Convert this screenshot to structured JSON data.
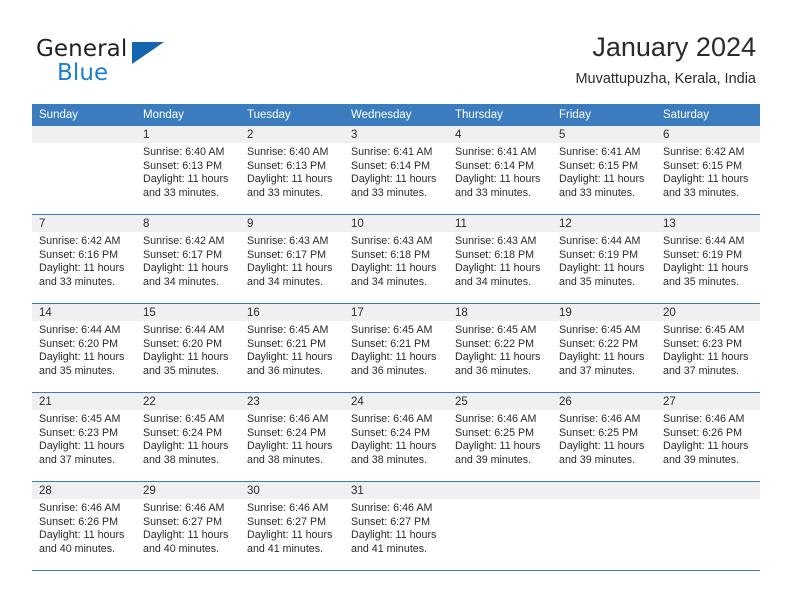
{
  "brand": {
    "name_part1": "General",
    "name_part2": "Blue",
    "logo_icon": "triangle-logo-icon"
  },
  "header": {
    "title": "January 2024",
    "subtitle": "Muvattupuzha, Kerala, India"
  },
  "colors": {
    "header_blue": "#3a7cbe",
    "brand_blue": "#1b7fd4",
    "daynum_band": "#f0f0f0",
    "text": "#2b2b2b"
  },
  "calendar": {
    "weekday_headers": [
      "Sunday",
      "Monday",
      "Tuesday",
      "Wednesday",
      "Thursday",
      "Friday",
      "Saturday"
    ],
    "weeks": [
      [
        {
          "day": "",
          "empty": true,
          "sunrise": "",
          "sunset": "",
          "daylight_line1": "",
          "daylight_line2": ""
        },
        {
          "day": "1",
          "empty": false,
          "sunrise": "Sunrise: 6:40 AM",
          "sunset": "Sunset: 6:13 PM",
          "daylight_line1": "Daylight: 11 hours",
          "daylight_line2": "and 33 minutes."
        },
        {
          "day": "2",
          "empty": false,
          "sunrise": "Sunrise: 6:40 AM",
          "sunset": "Sunset: 6:13 PM",
          "daylight_line1": "Daylight: 11 hours",
          "daylight_line2": "and 33 minutes."
        },
        {
          "day": "3",
          "empty": false,
          "sunrise": "Sunrise: 6:41 AM",
          "sunset": "Sunset: 6:14 PM",
          "daylight_line1": "Daylight: 11 hours",
          "daylight_line2": "and 33 minutes."
        },
        {
          "day": "4",
          "empty": false,
          "sunrise": "Sunrise: 6:41 AM",
          "sunset": "Sunset: 6:14 PM",
          "daylight_line1": "Daylight: 11 hours",
          "daylight_line2": "and 33 minutes."
        },
        {
          "day": "5",
          "empty": false,
          "sunrise": "Sunrise: 6:41 AM",
          "sunset": "Sunset: 6:15 PM",
          "daylight_line1": "Daylight: 11 hours",
          "daylight_line2": "and 33 minutes."
        },
        {
          "day": "6",
          "empty": false,
          "sunrise": "Sunrise: 6:42 AM",
          "sunset": "Sunset: 6:15 PM",
          "daylight_line1": "Daylight: 11 hours",
          "daylight_line2": "and 33 minutes."
        }
      ],
      [
        {
          "day": "7",
          "empty": false,
          "sunrise": "Sunrise: 6:42 AM",
          "sunset": "Sunset: 6:16 PM",
          "daylight_line1": "Daylight: 11 hours",
          "daylight_line2": "and 33 minutes."
        },
        {
          "day": "8",
          "empty": false,
          "sunrise": "Sunrise: 6:42 AM",
          "sunset": "Sunset: 6:17 PM",
          "daylight_line1": "Daylight: 11 hours",
          "daylight_line2": "and 34 minutes."
        },
        {
          "day": "9",
          "empty": false,
          "sunrise": "Sunrise: 6:43 AM",
          "sunset": "Sunset: 6:17 PM",
          "daylight_line1": "Daylight: 11 hours",
          "daylight_line2": "and 34 minutes."
        },
        {
          "day": "10",
          "empty": false,
          "sunrise": "Sunrise: 6:43 AM",
          "sunset": "Sunset: 6:18 PM",
          "daylight_line1": "Daylight: 11 hours",
          "daylight_line2": "and 34 minutes."
        },
        {
          "day": "11",
          "empty": false,
          "sunrise": "Sunrise: 6:43 AM",
          "sunset": "Sunset: 6:18 PM",
          "daylight_line1": "Daylight: 11 hours",
          "daylight_line2": "and 34 minutes."
        },
        {
          "day": "12",
          "empty": false,
          "sunrise": "Sunrise: 6:44 AM",
          "sunset": "Sunset: 6:19 PM",
          "daylight_line1": "Daylight: 11 hours",
          "daylight_line2": "and 35 minutes."
        },
        {
          "day": "13",
          "empty": false,
          "sunrise": "Sunrise: 6:44 AM",
          "sunset": "Sunset: 6:19 PM",
          "daylight_line1": "Daylight: 11 hours",
          "daylight_line2": "and 35 minutes."
        }
      ],
      [
        {
          "day": "14",
          "empty": false,
          "sunrise": "Sunrise: 6:44 AM",
          "sunset": "Sunset: 6:20 PM",
          "daylight_line1": "Daylight: 11 hours",
          "daylight_line2": "and 35 minutes."
        },
        {
          "day": "15",
          "empty": false,
          "sunrise": "Sunrise: 6:44 AM",
          "sunset": "Sunset: 6:20 PM",
          "daylight_line1": "Daylight: 11 hours",
          "daylight_line2": "and 35 minutes."
        },
        {
          "day": "16",
          "empty": false,
          "sunrise": "Sunrise: 6:45 AM",
          "sunset": "Sunset: 6:21 PM",
          "daylight_line1": "Daylight: 11 hours",
          "daylight_line2": "and 36 minutes."
        },
        {
          "day": "17",
          "empty": false,
          "sunrise": "Sunrise: 6:45 AM",
          "sunset": "Sunset: 6:21 PM",
          "daylight_line1": "Daylight: 11 hours",
          "daylight_line2": "and 36 minutes."
        },
        {
          "day": "18",
          "empty": false,
          "sunrise": "Sunrise: 6:45 AM",
          "sunset": "Sunset: 6:22 PM",
          "daylight_line1": "Daylight: 11 hours",
          "daylight_line2": "and 36 minutes."
        },
        {
          "day": "19",
          "empty": false,
          "sunrise": "Sunrise: 6:45 AM",
          "sunset": "Sunset: 6:22 PM",
          "daylight_line1": "Daylight: 11 hours",
          "daylight_line2": "and 37 minutes."
        },
        {
          "day": "20",
          "empty": false,
          "sunrise": "Sunrise: 6:45 AM",
          "sunset": "Sunset: 6:23 PM",
          "daylight_line1": "Daylight: 11 hours",
          "daylight_line2": "and 37 minutes."
        }
      ],
      [
        {
          "day": "21",
          "empty": false,
          "sunrise": "Sunrise: 6:45 AM",
          "sunset": "Sunset: 6:23 PM",
          "daylight_line1": "Daylight: 11 hours",
          "daylight_line2": "and 37 minutes."
        },
        {
          "day": "22",
          "empty": false,
          "sunrise": "Sunrise: 6:45 AM",
          "sunset": "Sunset: 6:24 PM",
          "daylight_line1": "Daylight: 11 hours",
          "daylight_line2": "and 38 minutes."
        },
        {
          "day": "23",
          "empty": false,
          "sunrise": "Sunrise: 6:46 AM",
          "sunset": "Sunset: 6:24 PM",
          "daylight_line1": "Daylight: 11 hours",
          "daylight_line2": "and 38 minutes."
        },
        {
          "day": "24",
          "empty": false,
          "sunrise": "Sunrise: 6:46 AM",
          "sunset": "Sunset: 6:24 PM",
          "daylight_line1": "Daylight: 11 hours",
          "daylight_line2": "and 38 minutes."
        },
        {
          "day": "25",
          "empty": false,
          "sunrise": "Sunrise: 6:46 AM",
          "sunset": "Sunset: 6:25 PM",
          "daylight_line1": "Daylight: 11 hours",
          "daylight_line2": "and 39 minutes."
        },
        {
          "day": "26",
          "empty": false,
          "sunrise": "Sunrise: 6:46 AM",
          "sunset": "Sunset: 6:25 PM",
          "daylight_line1": "Daylight: 11 hours",
          "daylight_line2": "and 39 minutes."
        },
        {
          "day": "27",
          "empty": false,
          "sunrise": "Sunrise: 6:46 AM",
          "sunset": "Sunset: 6:26 PM",
          "daylight_line1": "Daylight: 11 hours",
          "daylight_line2": "and 39 minutes."
        }
      ],
      [
        {
          "day": "28",
          "empty": false,
          "sunrise": "Sunrise: 6:46 AM",
          "sunset": "Sunset: 6:26 PM",
          "daylight_line1": "Daylight: 11 hours",
          "daylight_line2": "and 40 minutes."
        },
        {
          "day": "29",
          "empty": false,
          "sunrise": "Sunrise: 6:46 AM",
          "sunset": "Sunset: 6:27 PM",
          "daylight_line1": "Daylight: 11 hours",
          "daylight_line2": "and 40 minutes."
        },
        {
          "day": "30",
          "empty": false,
          "sunrise": "Sunrise: 6:46 AM",
          "sunset": "Sunset: 6:27 PM",
          "daylight_line1": "Daylight: 11 hours",
          "daylight_line2": "and 41 minutes."
        },
        {
          "day": "31",
          "empty": false,
          "sunrise": "Sunrise: 6:46 AM",
          "sunset": "Sunset: 6:27 PM",
          "daylight_line1": "Daylight: 11 hours",
          "daylight_line2": "and 41 minutes."
        },
        {
          "day": "",
          "empty": true,
          "sunrise": "",
          "sunset": "",
          "daylight_line1": "",
          "daylight_line2": ""
        },
        {
          "day": "",
          "empty": true,
          "sunrise": "",
          "sunset": "",
          "daylight_line1": "",
          "daylight_line2": ""
        },
        {
          "day": "",
          "empty": true,
          "sunrise": "",
          "sunset": "",
          "daylight_line1": "",
          "daylight_line2": ""
        }
      ]
    ]
  }
}
